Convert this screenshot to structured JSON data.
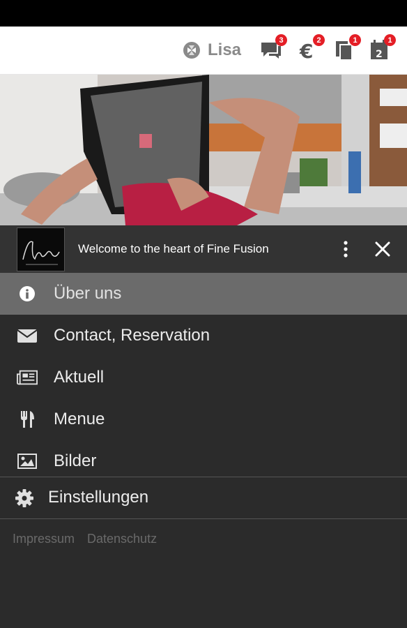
{
  "topbar": {
    "user_name": "Lisa",
    "badges": {
      "chat": "3",
      "payment": "2",
      "documents": "1",
      "calendar": "1"
    },
    "calendar_day": "2"
  },
  "welcome": {
    "text": "Welcome to the heart of Fine Fusion"
  },
  "menu": {
    "items": [
      {
        "label": "Über uns",
        "icon": "info-icon"
      },
      {
        "label": "Contact, Reservation",
        "icon": "envelope-icon"
      },
      {
        "label": "Aktuell",
        "icon": "newspaper-icon"
      },
      {
        "label": "Menue",
        "icon": "utensils-icon"
      },
      {
        "label": "Bilder",
        "icon": "image-icon"
      }
    ],
    "settings": {
      "label": "Einstellungen",
      "icon": "gear-icon"
    }
  },
  "footer": {
    "impressum": "Impressum",
    "datenschutz": "Datenschutz"
  },
  "colors": {
    "badge": "#e41e26",
    "panel": "#2b2b2b",
    "active": "#6b6b6b"
  }
}
